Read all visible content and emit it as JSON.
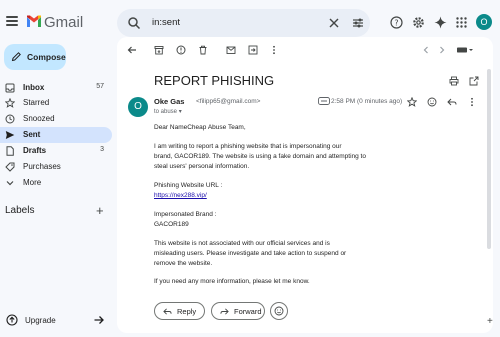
{
  "app": {
    "brand": "Gmail"
  },
  "search": {
    "query": "in:sent"
  },
  "sidebar": {
    "compose_label": "Compose",
    "items": [
      {
        "label": "Inbox",
        "count": "57",
        "bold": true
      },
      {
        "label": "Starred",
        "count": ""
      },
      {
        "label": "Snoozed",
        "count": ""
      },
      {
        "label": "Sent",
        "count": "",
        "active": true,
        "bold": true
      },
      {
        "label": "Drafts",
        "count": "3",
        "bold": true
      },
      {
        "label": "Purchases",
        "count": ""
      },
      {
        "label": "More",
        "count": ""
      }
    ],
    "labels_heading": "Labels",
    "upgrade_label": "Upgrade"
  },
  "email": {
    "subject": "REPORT PHISHING",
    "avatar_letter": "O",
    "sender_name": "Oke Gas",
    "sender_email": "<filipp65@gmail.com>",
    "to_line": "to abuse",
    "time": "2:58 PM (0 minutes ago)",
    "body": {
      "l1": "Dear NameCheap Abuse Team,",
      "l2": "I am writing to report a phishing website that is impersonating our",
      "l3": "brand, GACOR189. The website is using a fake domain and attempting to",
      "l4": "steal users' personal information.",
      "l5": "Phishing Website URL :",
      "l6": "https://nex288.vip/",
      "l7": "Impersonated Brand :",
      "l8": "GACOR189",
      "l9": "This website is not associated with our official services and is",
      "l10": "misleading users. Please investigate and take action to suspend or",
      "l11": "remove the website.",
      "l12": "If you need any more information, please let me know."
    },
    "reply_label": "Reply",
    "forward_label": "Forward"
  },
  "colors": {
    "accent": "#0b57d0",
    "avatar": "#0b8a8a",
    "compose_bg": "#c2e7ff",
    "active_nav": "#d3e3fd"
  }
}
